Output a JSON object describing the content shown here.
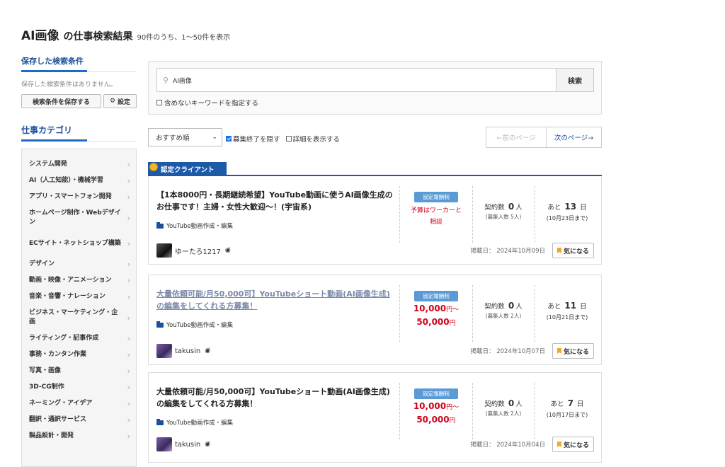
{
  "header": {
    "keyword": "AI画像",
    "suffix": "の仕事検索結果",
    "count": "90件のうち、1〜50件を表示"
  },
  "sidebar": {
    "saved_heading": "保存した検索条件",
    "saved_empty": "保存した検索条件はありません。",
    "save_button": "検索条件を保存する",
    "settings_button": "設定",
    "category_heading": "仕事カテゴリ",
    "categories": [
      "システム開発",
      "AI（人工知能）・機械学習",
      "アプリ・スマートフォン開発",
      "ホームページ制作・Webデザイン",
      "ECサイト・ネットショップ構築",
      "デザイン",
      "動画・映像・アニメーション",
      "音楽・音響・ナレーション",
      "ビジネス・マーケティング・企画",
      "ライティング・記事作成",
      "事務・カンタン作業",
      "写真・画像",
      "3D-CG制作",
      "ネーミング・アイデア",
      "翻訳・通訳サービス",
      "製品設計・開発"
    ]
  },
  "search": {
    "value": "AI画像",
    "button": "検索",
    "exclude_label": "含めないキーワードを指定する"
  },
  "controls": {
    "sort_selected": "おすすめ順",
    "hide_closed": "募集終了を隠す",
    "show_details": "詳細を表示する",
    "prev_page": "←前のページ",
    "next_page": "次のページ→"
  },
  "certified_label": "認定クライアント",
  "jobs": [
    {
      "title": "【1本8000円・長期継続希望】YouTube動画に使うAI画像生成のお仕事です！主婦・女性大歓迎〜！(宇宙系)",
      "category": "YouTube動画作成・編集",
      "badge": "固定報酬制",
      "budget_text": "予算はワーカーと相談",
      "contracts_label": "契約数",
      "contracts": "0",
      "contracts_unit": "人",
      "recruit": "(募集人数 5人)",
      "deadline_prefix": "あと",
      "deadline_days": "13",
      "deadline_unit": "日",
      "deadline_date": "(10月23日まで)",
      "user": "ゆーたろ1217",
      "posted": "掲載日： 2024年10月09日",
      "fav": "気になる"
    },
    {
      "title": "大量依頼可能/月50,000可】YouTubeショート動画(AI画像生成)の編集をしてくれる方募集！",
      "category": "YouTube動画作成・編集",
      "badge": "固定報酬制",
      "budget_min": "10,000",
      "budget_max": "50,000",
      "yen": "円",
      "tilde": "〜",
      "contracts_label": "契約数",
      "contracts": "0",
      "contracts_unit": "人",
      "recruit": "(募集人数 2人)",
      "deadline_prefix": "あと",
      "deadline_days": "11",
      "deadline_unit": "日",
      "deadline_date": "(10月21日まで)",
      "user": "takusin",
      "posted": "掲載日： 2024年10月07日",
      "fav": "気になる"
    },
    {
      "title": "大量依頼可能/月50,000可】YouTubeショート動画(AI画像生成)の編集をしてくれる方募集！",
      "category": "YouTube動画作成・編集",
      "badge": "固定報酬制",
      "budget_min": "10,000",
      "budget_max": "50,000",
      "yen": "円",
      "tilde": "〜",
      "contracts_label": "契約数",
      "contracts": "0",
      "contracts_unit": "人",
      "recruit": "(募集人数 2人)",
      "deadline_prefix": "あと",
      "deadline_days": "7",
      "deadline_unit": "日",
      "deadline_date": "(10月17日まで)",
      "user": "takusin",
      "posted": "掲載日： 2024年10月04日",
      "fav": "気になる"
    }
  ]
}
